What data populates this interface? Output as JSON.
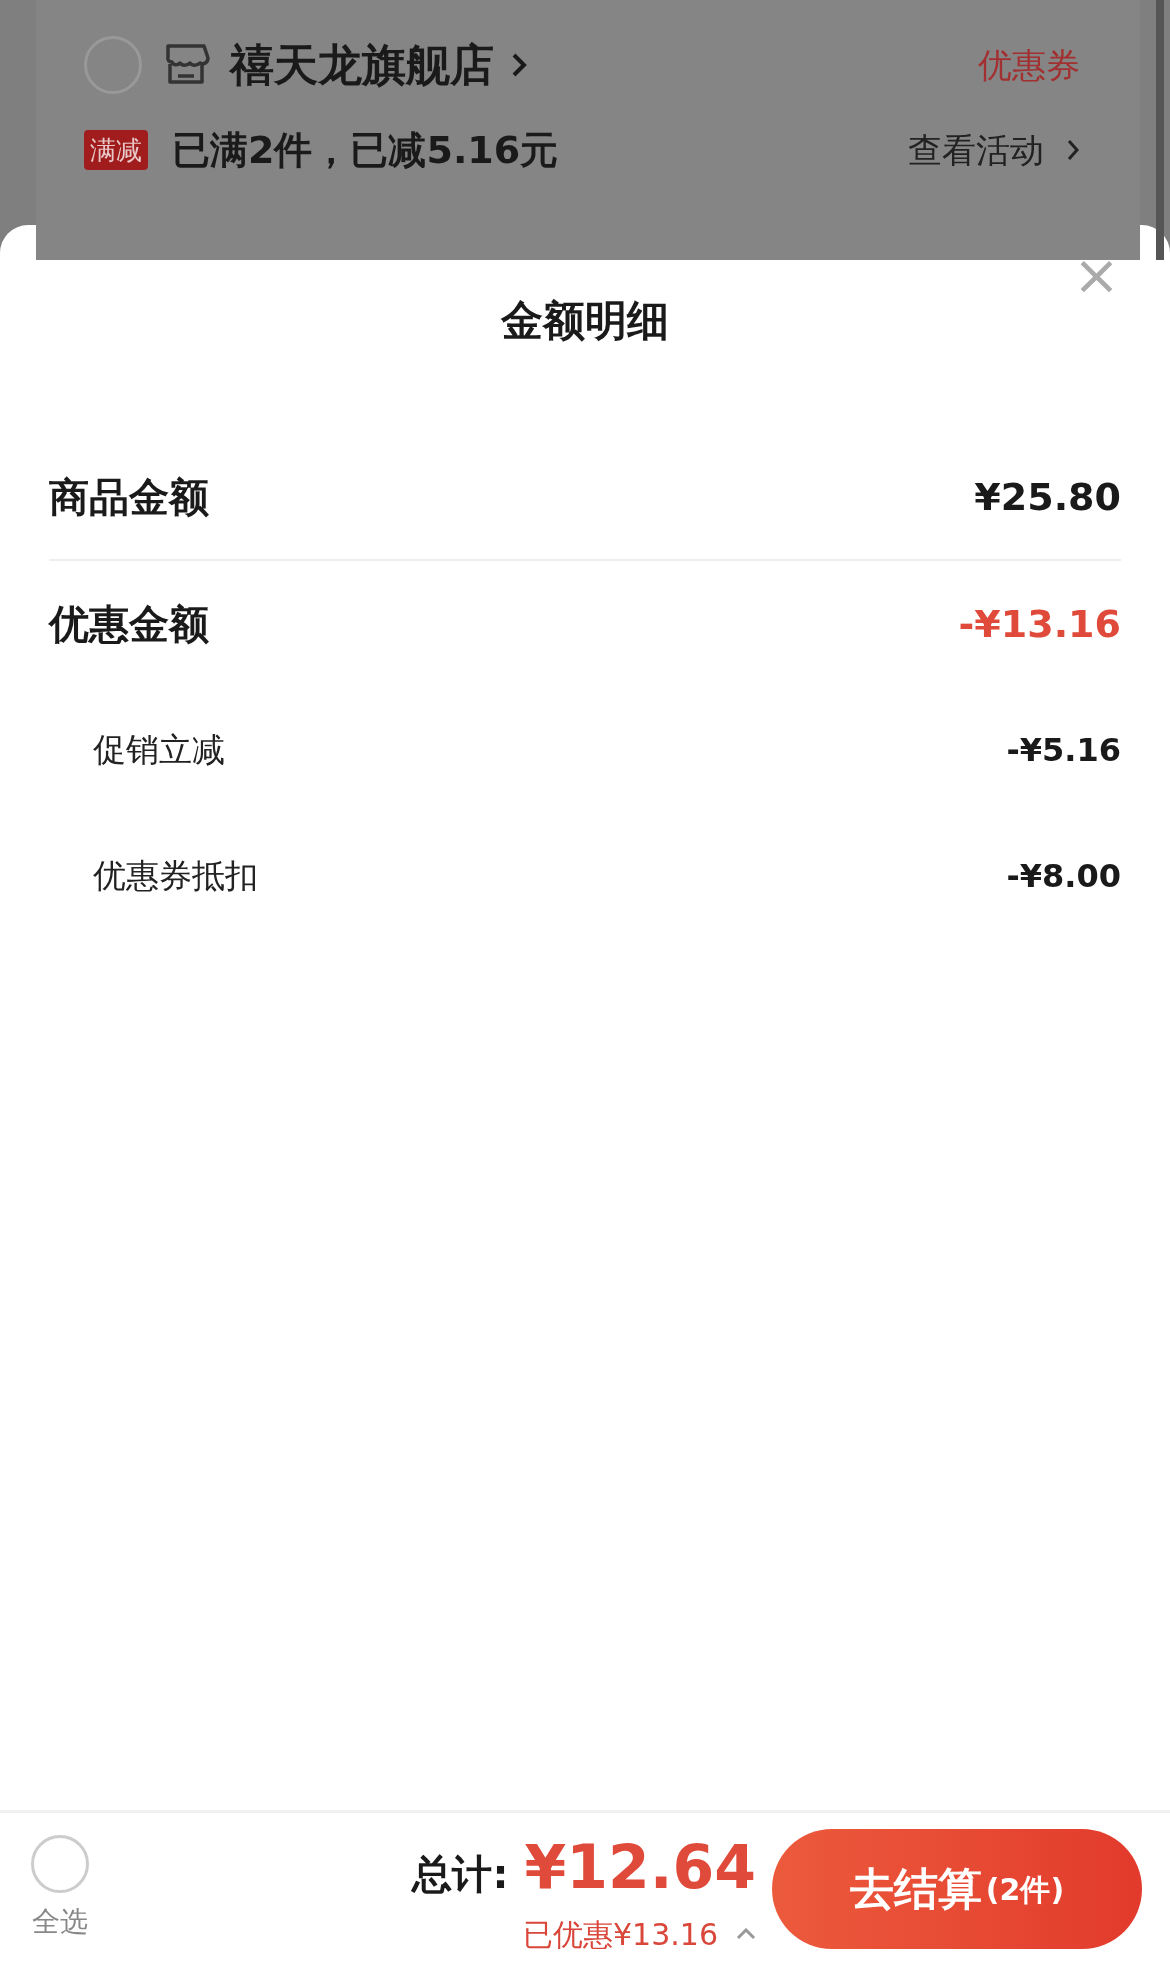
{
  "background": {
    "shop": {
      "name": "禧天龙旗舰店",
      "selected": false,
      "coupon": "优惠券"
    },
    "promo": {
      "tag": "满减",
      "text": "已满2件，已减5.16元",
      "link": "查看活动"
    }
  },
  "sheet": {
    "title": "金额明细",
    "close": "×",
    "rows": [
      {
        "kind": "main",
        "label": "商品金额",
        "value": "¥25.80",
        "highlight": false
      },
      {
        "kind": "main",
        "label": "优惠金额",
        "value": "-¥13.16",
        "highlight": true
      },
      {
        "kind": "sub",
        "label": "促销立减",
        "value": "-¥5.16",
        "highlight": false
      },
      {
        "kind": "sub",
        "label": "优惠券抵扣",
        "value": "-¥8.00",
        "highlight": false
      }
    ]
  },
  "footer": {
    "select_all": {
      "label": "全选",
      "checked": false
    },
    "total_label": "总计:",
    "total": "¥12.64",
    "saved": "已优惠¥13.16",
    "checkout": "去结算",
    "checkout_count": "(2件)"
  }
}
